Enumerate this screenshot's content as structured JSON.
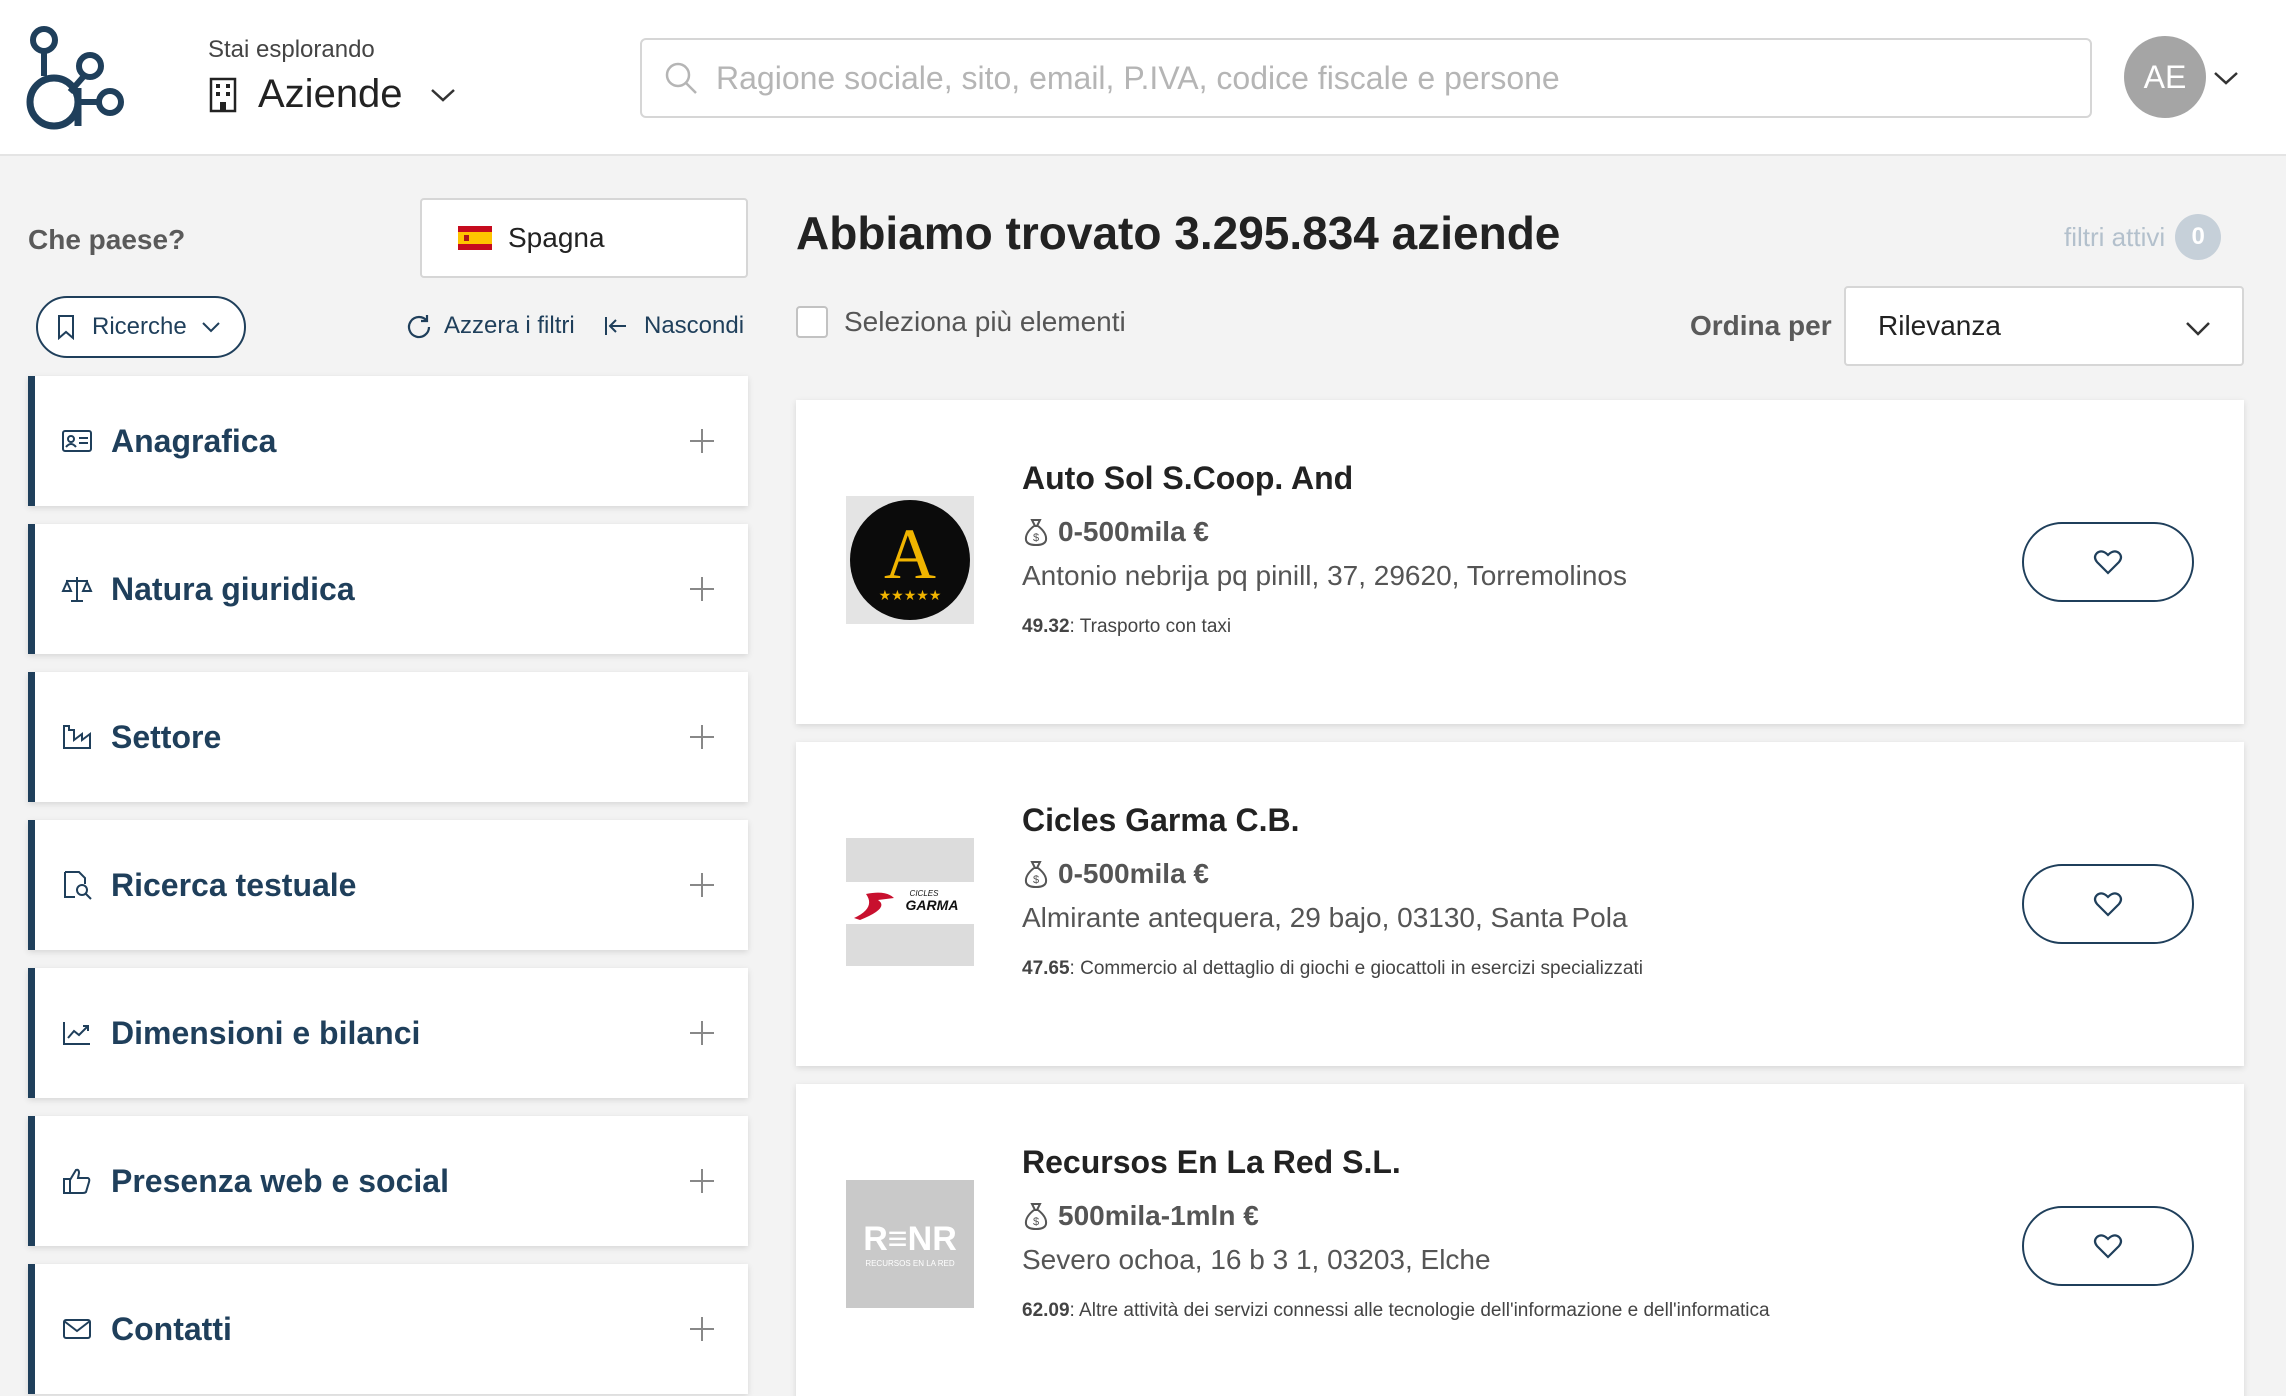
{
  "header": {
    "explore_sub": "Stai esplorando",
    "explore_main": "Aziende",
    "search_placeholder": "Ragione sociale, sito, email, P.IVA, codice fiscale e persone",
    "avatar_initials": "AE"
  },
  "sidebar": {
    "country_label": "Che paese?",
    "country_value": "Spagna",
    "ricerche_label": "Ricerche",
    "reset_label": "Azzera i filtri",
    "hide_label": "Nascondi",
    "filters": [
      {
        "label": "Anagrafica",
        "icon": "id-card-icon"
      },
      {
        "label": "Natura giuridica",
        "icon": "scale-icon"
      },
      {
        "label": "Settore",
        "icon": "factory-icon"
      },
      {
        "label": "Ricerca testuale",
        "icon": "document-search-icon"
      },
      {
        "label": "Dimensioni e bilanci",
        "icon": "chart-line-icon"
      },
      {
        "label": "Presenza web e social",
        "icon": "thumbs-up-icon"
      },
      {
        "label": "Contatti",
        "icon": "envelope-icon"
      }
    ]
  },
  "main": {
    "result_title": "Abbiamo trovato 3.295.834 aziende",
    "active_filters_label": "filtri attivi",
    "active_filters_count": "0",
    "multi_select_label": "Seleziona più elementi",
    "order_label": "Ordina per",
    "order_value": "Rilevanza",
    "results": [
      {
        "name": "Auto Sol S.Coop. And",
        "revenue": "0-500mila €",
        "address": "Antonio nebrija pq pinill, 37, 29620, Torremolinos",
        "ateco_code": "49.32",
        "ateco_desc": ": Trasporto con taxi",
        "logo_text": "A"
      },
      {
        "name": "Cicles Garma C.B.",
        "revenue": "0-500mila €",
        "address": "Almirante antequera, 29 bajo, 03130, Santa Pola",
        "ateco_code": "47.65",
        "ateco_desc": ": Commercio al dettaglio di giochi e giocattoli in esercizi specializzati",
        "logo_text": "GARMA",
        "logo_sub": "CICLES"
      },
      {
        "name": "Recursos En La Red S.L.",
        "revenue": "500mila-1mln €",
        "address": "Severo ochoa, 16 b 3 1, 03203, Elche",
        "ateco_code": "62.09",
        "ateco_desc": ": Altre attività dei servizi connessi alle tecnologie dell'informazione e dell'informatica",
        "logo_text": "R≡NR",
        "logo_sub": "RECURSOS EN LA RED"
      }
    ]
  },
  "colors": {
    "primary": "#1f3f5b",
    "background": "#f3f3f3",
    "avatar": "#a5a5a5",
    "badge": "#c6d0d9"
  }
}
